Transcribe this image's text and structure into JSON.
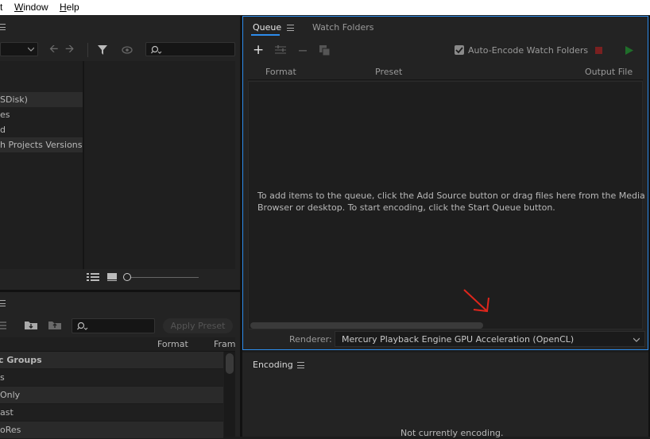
{
  "menu": {
    "items": [
      "t",
      "Window",
      "Help"
    ],
    "underline": [
      "",
      "W",
      "H"
    ]
  },
  "media_browser": {
    "tree_items": [
      "SDisk)",
      "es",
      "d",
      "h Projects Versions"
    ]
  },
  "preset_browser": {
    "search_placeholder": "",
    "apply_label": "Apply Preset",
    "columns": {
      "format": "Format",
      "frame": "Fram"
    },
    "rows": [
      "Groups",
      "s",
      "Only",
      "ast",
      "oRes"
    ]
  },
  "queue": {
    "tab_queue": "Queue",
    "tab_watch": "Watch Folders",
    "auto_encode_label": "Auto-Encode Watch Folders",
    "auto_encode_checked": true,
    "columns": {
      "format": "Format",
      "preset": "Preset",
      "output": "Output File"
    },
    "empty_line1": "To add items to the queue, click the Add Source button or drag files here from the Media",
    "empty_line2": "Browser or desktop.  To start encoding, click the Start Queue button.",
    "renderer_label": "Renderer:",
    "renderer_value": "Mercury Playback Engine GPU Acceleration (OpenCL)"
  },
  "encoding": {
    "title": "Encoding",
    "status": "Not currently encoding."
  },
  "colors": {
    "accent": "#2d8ceb",
    "stop": "#7a2020",
    "play": "#1f6e2a",
    "annotation": "#e0261c"
  }
}
